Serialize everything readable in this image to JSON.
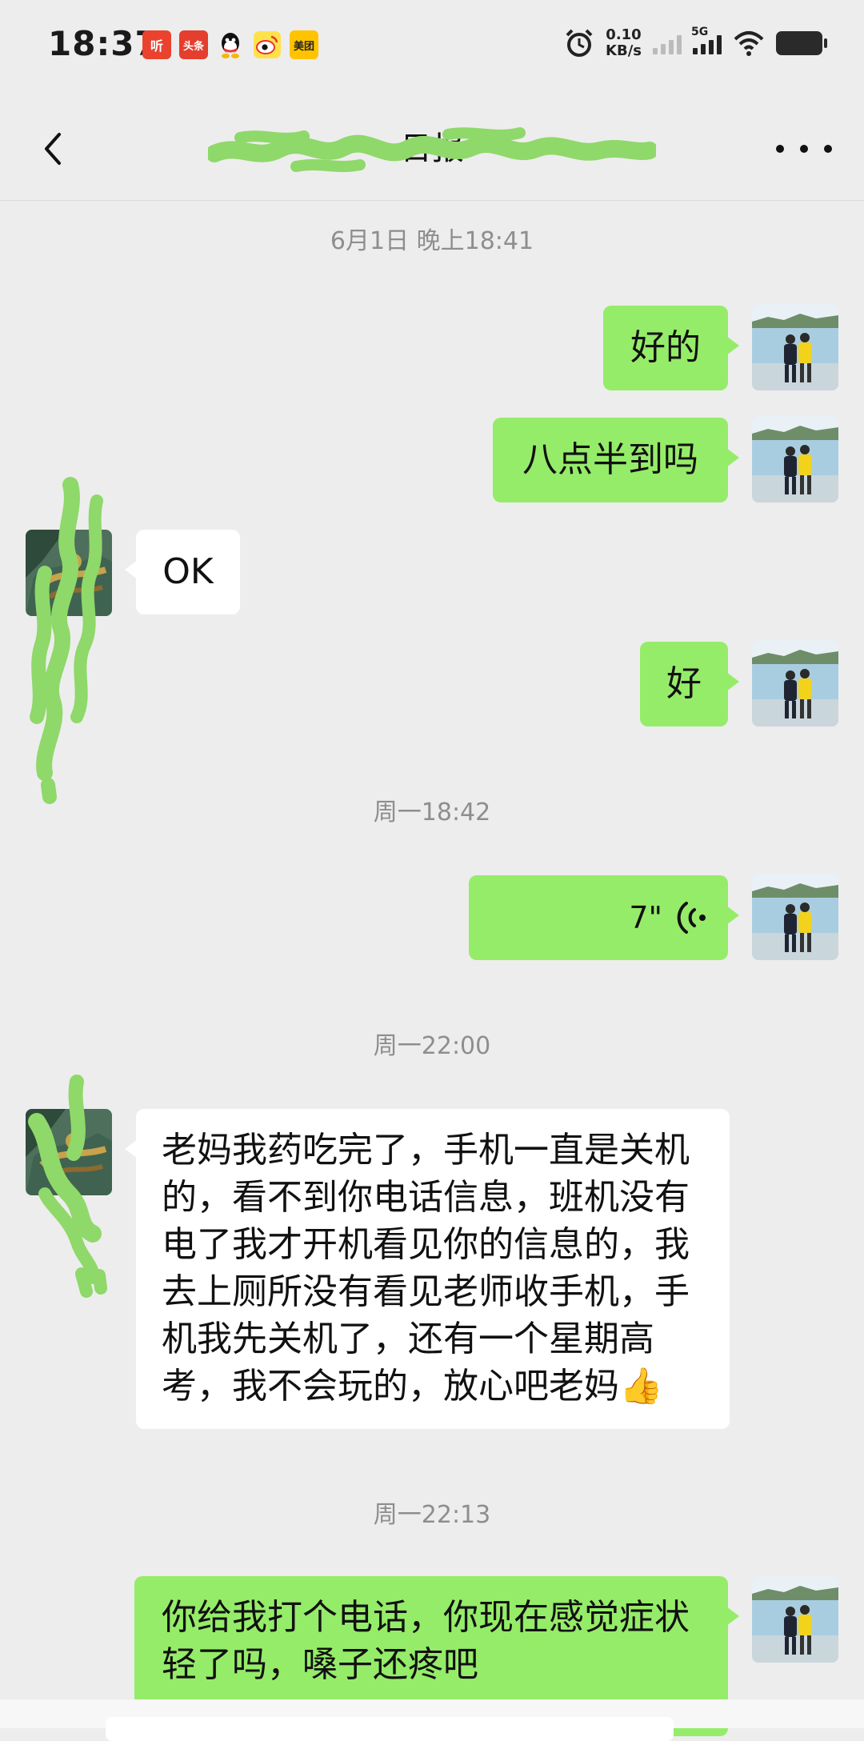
{
  "status_bar": {
    "time": "18:37",
    "apps": [
      {
        "icon": "ting-app-icon",
        "label": "听"
      },
      {
        "icon": "toutiao-app-icon",
        "label": "头条"
      },
      {
        "icon": "qq-app-icon",
        "label": ""
      },
      {
        "icon": "weibo-app-icon",
        "label": ""
      },
      {
        "icon": "meituan-app-icon",
        "label": "美团"
      }
    ],
    "net_speed_value": "0.10",
    "net_speed_unit": "KB/s",
    "network": "5G"
  },
  "header": {
    "title": "日报",
    "back_icon": "chevron-left-icon",
    "more_icon": "more-dots-icon"
  },
  "colors": {
    "background": "#EDEDED",
    "my_bubble": "#95EC69",
    "other_bubble": "#FFFFFF",
    "timestamp": "#8E8E8E",
    "redaction": "#8FD86A"
  },
  "timestamps": {
    "t1": "6月1日 晚上18:41",
    "t2": "周一18:42",
    "t3": "周一22:00",
    "t4": "周一22:13"
  },
  "messages": {
    "m1": "好的",
    "m2": "八点半到吗",
    "m3": "OK",
    "m4": "好",
    "m5_duration": "7\"",
    "m6_lines": [
      "老妈我药吃完了，手机一直是关机",
      "的，看不到你电话信息，班机没有",
      "电了我才开机看见你的信息的，我",
      "去上厕所没有看见老师收手机，手",
      "机我先关机了，还有一个星期高",
      "考，我不会玩的，放心吧老妈👍"
    ],
    "m7_lines": [
      "你给我打个电话，你现在感觉症状",
      "轻了吗，嗓子还疼吧"
    ]
  }
}
